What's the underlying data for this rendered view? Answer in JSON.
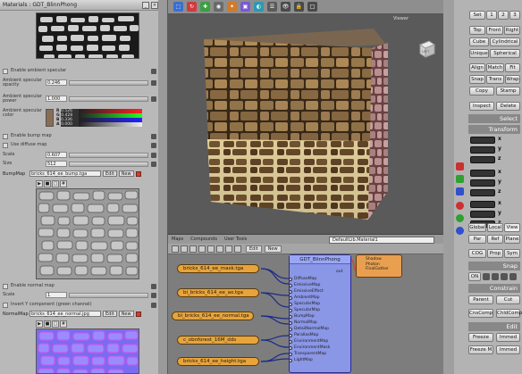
{
  "material_panel": {
    "title": "Materials : GDT_BlinnPhong",
    "rows": [
      {
        "label": "Enable ambient specular"
      },
      {
        "label": "Ambient specular opacity",
        "value": "0.246"
      },
      {
        "label": "Ambient specular power",
        "value": "1.000"
      },
      {
        "label": "Ambient specular color",
        "r": "0.526",
        "g": "0.428",
        "b": "0.336",
        "a": "0.000"
      },
      {
        "label": "Enable bump map"
      },
      {
        "label": "Use diffuse map"
      },
      {
        "label": "Scale",
        "value": "0.607"
      },
      {
        "label": "Size",
        "value": "512"
      }
    ],
    "bump_map": {
      "label": "BumpMap",
      "file": "bricks_614_ee_bump.tga",
      "edit": "Edit",
      "new": "New"
    },
    "normal_rows": [
      {
        "label": "Enable normal map"
      },
      {
        "label": "Scale",
        "value": "1"
      },
      {
        "label": "Invert Y component (green channel)"
      }
    ],
    "normal_map": {
      "label": "NormalMap",
      "file": "bricks_614_ee_normal.jpg",
      "edit": "Edit",
      "new": "New"
    }
  },
  "toolbar": {
    "view_label": "Viewer"
  },
  "node_editor": {
    "tabs": [
      "Maps",
      "Compounds",
      "User Tools"
    ],
    "dropdown": "DefaultLib.Material1",
    "edit": "Edit",
    "new": "New",
    "texture_nodes": [
      "bricks_614_ee_mask.tga",
      "bi_bricks_614_ee_ao.tga",
      "bi_bricks_614_ee_normal.tga",
      "c_obnforest_16M_dds",
      "bricks_614_ee_height.tga"
    ],
    "blinn_node": {
      "title": "GDT_BlinnPhong",
      "out": "out",
      "ports": [
        "DiffuseMap",
        "EmissiveMap",
        "EmissiveEffect",
        "AmbientMap",
        "SpecularMap",
        "SpecularMap",
        "BumpMap",
        "NormalMap",
        "DetailNormalMap",
        "ParallaxMap",
        "EnvironmentMap",
        "EnvironmentMask",
        "TransparentMap",
        "LightMap"
      ]
    },
    "output_node": {
      "ports": [
        "Shadow",
        "Photon",
        "FinalGather"
      ]
    }
  },
  "right_panel": {
    "top_buttons": [
      [
        "Set",
        "1",
        "2",
        "3"
      ],
      [
        "Top",
        "Front",
        "Right"
      ],
      [
        "Cube",
        "Cylindrical"
      ],
      [
        "Unique",
        "Spherical"
      ],
      [
        "Align",
        "Match",
        "Fit"
      ],
      [
        "Snap",
        "Trans",
        "Wrap"
      ]
    ],
    "copy": "Copy",
    "stamp": "Stamp",
    "inspect": "Inspect",
    "delete": "Delete",
    "select": "Select",
    "transform": "Transform",
    "axes": [
      "x",
      "y",
      "z"
    ],
    "global": "Global",
    "local": "Local",
    "view": "View",
    "par": "Par",
    "ref": "Ref",
    "plane": "Plane",
    "cog": "COG",
    "prop": "Prop",
    "sym": "Sym",
    "snap": "Snap",
    "on": "ON",
    "constrain": "Constrain",
    "parent": "Parent",
    "cut": "Cut",
    "cnscomp": "CnsComp",
    "chldcomp": "ChldComp",
    "edit": "Edit",
    "freeze": "Freeze",
    "immed": "Immed",
    "freeze_m": "Freeze M",
    "freeze_m2": "Immed"
  },
  "colors": {
    "accent": "#e8a43a",
    "blinn": "#8a96e6"
  }
}
